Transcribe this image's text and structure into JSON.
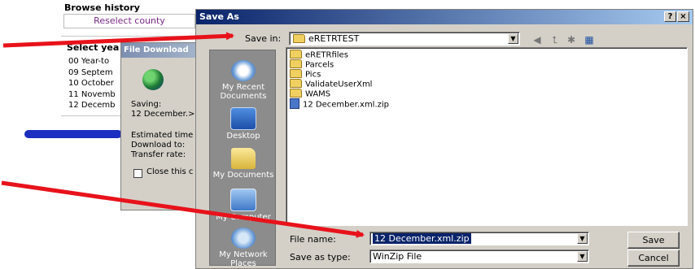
{
  "browse": {
    "heading": "Browse history",
    "reselect": "Reselect county",
    "select_label": "Select yea",
    "years": [
      "00 Year-to",
      "09 Septem",
      "10 October",
      "11 Novemb",
      "12 Decemb"
    ]
  },
  "file_download": {
    "title": "File Download",
    "saving_label": "Saving:",
    "saving_value": "12 December.>",
    "estimated": "Estimated time",
    "download_to": "Download to:",
    "transfer": "Transfer rate:",
    "close_label": "Close this c"
  },
  "dialog": {
    "title": "Save As",
    "help": "?",
    "close": "×",
    "save_in_label": "Save in:",
    "save_in_value": "eRETRTEST",
    "places": [
      "My Recent Documents",
      "Desktop",
      "My Documents",
      "My Computer",
      "My Network Places"
    ],
    "files": [
      {
        "name": "eRETRfiles",
        "type": "folder"
      },
      {
        "name": "Parcels",
        "type": "folder"
      },
      {
        "name": "Pics",
        "type": "folder"
      },
      {
        "name": "ValidateUserXml",
        "type": "folder"
      },
      {
        "name": "WAMS",
        "type": "folder"
      },
      {
        "name": "12 December.xml.zip",
        "type": "zip"
      }
    ],
    "file_name_label": "File name:",
    "file_name_value": "12 December.xml.zip",
    "save_type_label": "Save as type:",
    "save_type_value": "WinZip File",
    "save_button": "Save",
    "cancel_button": "Cancel"
  },
  "colors": {
    "arrow": "#e8121b",
    "titlebar": "#0a246a",
    "blue_bar": "#1b2ec0"
  }
}
